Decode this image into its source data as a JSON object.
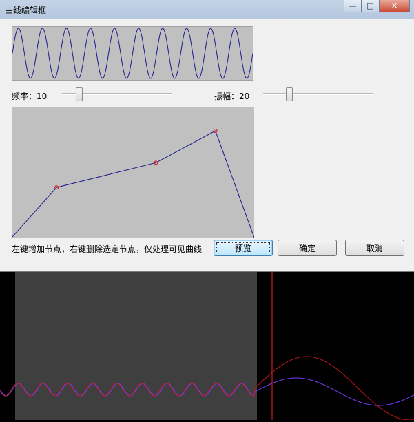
{
  "window": {
    "title": "曲线编辑框",
    "min_glyph": "—",
    "max_glyph": "□",
    "close_glyph": "✕"
  },
  "wave_preview": {
    "color": "#1a1a8c",
    "background": "#c0c0c0",
    "cycles": 10
  },
  "frequency": {
    "label": "频率：",
    "value": "10",
    "slider_fraction": 0.13
  },
  "amplitude": {
    "label": "振幅：",
    "value": "20",
    "slider_fraction": 0.22
  },
  "curve_editor": {
    "line_color": "#1a1a8c",
    "node_color": "#e00000",
    "nodes": [
      [
        0.0,
        0.0
      ],
      [
        0.185,
        0.385
      ],
      [
        0.595,
        0.575
      ],
      [
        0.84,
        0.82
      ],
      [
        1.0,
        0.0
      ]
    ],
    "node_markers": [
      1,
      2,
      3
    ]
  },
  "hint": "左键增加节点，右键删除选定节点，仅处理可见曲线",
  "buttons": {
    "preview": "预览",
    "ok": "确定",
    "cancel": "取消"
  },
  "waveform_view": {
    "background": "#000000",
    "selection_color": "#3f3f3f",
    "cursor_color": "#ff2020",
    "original_color": "#c01818",
    "processed_color": "#7a3cff"
  }
}
